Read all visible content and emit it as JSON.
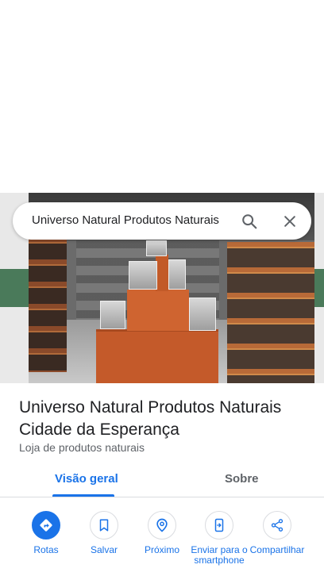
{
  "search": {
    "query": "Universo Natural Produtos Naturais"
  },
  "place": {
    "name": "Universo Natural Produtos Naturais Cidade da Esperança",
    "category": "Loja de produtos naturais"
  },
  "tabs": [
    {
      "label": "Visão geral",
      "selected": true
    },
    {
      "label": "Sobre",
      "selected": false
    }
  ],
  "actions": [
    {
      "label": "Rotas",
      "icon": "directions-icon"
    },
    {
      "label": "Salvar",
      "icon": "bookmark-icon"
    },
    {
      "label": "Próximo",
      "icon": "nearby-icon"
    },
    {
      "label": "Enviar para o smartphone",
      "icon": "send-to-phone-icon"
    },
    {
      "label": "Compartilhar",
      "icon": "share-icon"
    }
  ],
  "colors": {
    "accent": "#1a73e8",
    "text": "#202124",
    "secondary_text": "#5f6368"
  }
}
